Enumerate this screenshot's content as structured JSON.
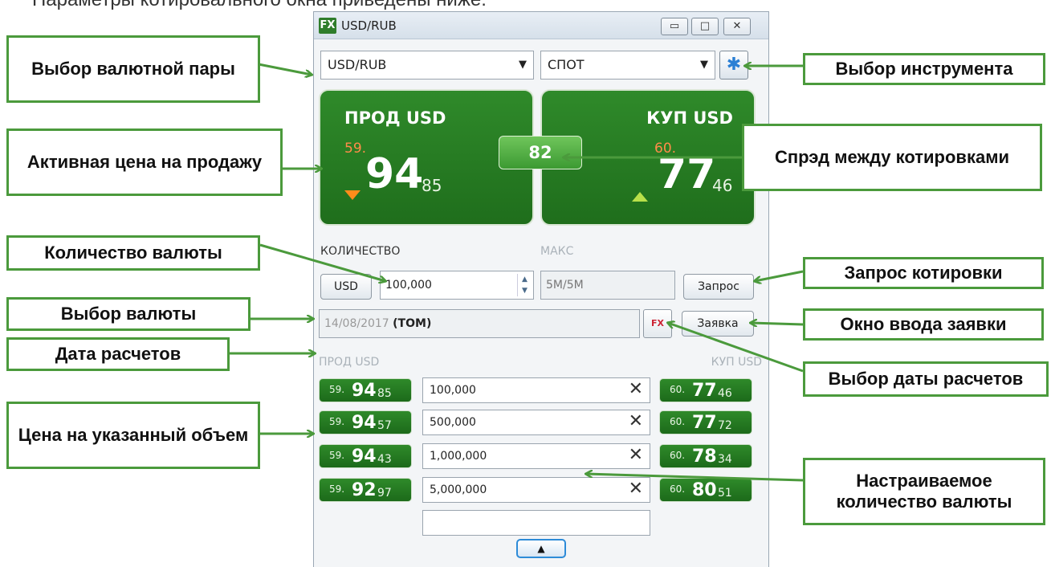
{
  "intro_text": "Параметры котировального окна приведены ниже:",
  "window": {
    "logo": "FX",
    "title": "USD/RUB",
    "buttons": {
      "minimize": "▭",
      "maximize": "□",
      "close": "✕"
    }
  },
  "pair_select": {
    "value": "USD/RUB",
    "arrow": "▼"
  },
  "instrument_select": {
    "value": "СПОТ",
    "arrow": "▼"
  },
  "sell_tile": {
    "header": "ПРОД USD",
    "big_figure": "59.",
    "figure": "94",
    "pips": "85",
    "direction": "down"
  },
  "buy_tile": {
    "header": "КУП USD",
    "big_figure": "60.",
    "figure": "77",
    "pips": "46",
    "direction": "up"
  },
  "spread": "82",
  "quantity": {
    "label": "КОЛИЧЕСТВО",
    "currency_button": "USD",
    "value": "100,000",
    "max_label": "МАКС",
    "max_value": "5M/5M",
    "request_button": "Запрос"
  },
  "settlement": {
    "date": "14/08/2017",
    "tenor": "(TOM)",
    "order_button": "Заявка",
    "calendar_icon_text": "FX"
  },
  "ladder": {
    "sell_header": "ПРОД USD",
    "buy_header": "КУП USD",
    "rows": [
      {
        "sell_small": "59.",
        "sell_big": "94",
        "sell_pips": "85",
        "qty": "100,000",
        "buy_small": "60.",
        "buy_big": "77",
        "buy_pips": "46"
      },
      {
        "sell_small": "59.",
        "sell_big": "94",
        "sell_pips": "57",
        "qty": "500,000",
        "buy_small": "60.",
        "buy_big": "77",
        "buy_pips": "72"
      },
      {
        "sell_small": "59.",
        "sell_big": "94",
        "sell_pips": "43",
        "qty": "1,000,000",
        "buy_small": "60.",
        "buy_big": "78",
        "buy_pips": "34"
      },
      {
        "sell_small": "59.",
        "sell_big": "92",
        "sell_pips": "97",
        "qty": "5,000,000",
        "buy_small": "60.",
        "buy_big": "80",
        "buy_pips": "51"
      }
    ],
    "remove_glyph": "✕",
    "empty_qty": ""
  },
  "toggle": "▲",
  "callouts": {
    "pair": "Выбор валютной пары",
    "instrument": "Выбор инструмента",
    "sell_price": "Активная цена на продажу",
    "spread": "Спрэд между котировками",
    "quantity": "Количество валюты",
    "request": "Запрос котировки",
    "currency": "Выбор валюты",
    "order": "Окно ввода заявки",
    "date": "Дата расчетов",
    "date_select": "Выбор даты расчетов",
    "volume_price": "Цена на указанный объем",
    "custom_qty": "Настраиваемое количество валюты"
  },
  "colors": {
    "tile_green": "#2f8a2a",
    "callout_border": "#4b9a3c",
    "down_arrow": "#ff8c1a",
    "up_arrow": "#b8e04a"
  }
}
